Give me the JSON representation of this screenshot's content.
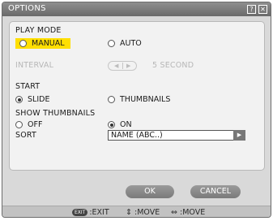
{
  "window": {
    "title": "OPTIONS",
    "help_icon": "?",
    "close_icon": "✕"
  },
  "play_mode": {
    "label": "PLAY MODE",
    "manual": "MANUAL",
    "auto": "AUTO",
    "selected": "MANUAL"
  },
  "interval": {
    "label": "INTERVAL",
    "left_arrow": "◀",
    "right_arrow": "▶",
    "value": "5 SECOND"
  },
  "start": {
    "label": "START",
    "slide": "SLIDE",
    "thumbnails": "THUMBNAILS",
    "selected": "SLIDE"
  },
  "show_thumbnails": {
    "label": "SHOW THUMBNAILS",
    "off": "OFF",
    "on": "ON",
    "selected": "ON"
  },
  "sort": {
    "label": "SORT",
    "value": "NAME (ABC..)",
    "arrow": "▶"
  },
  "buttons": {
    "ok": "OK",
    "cancel": "CANCEL"
  },
  "hints": {
    "exit_key": "EXIT",
    "exit": ":EXIT",
    "move_v_icon": "⇕",
    "move_v": ":MOVE",
    "move_h_icon": "⇔",
    "move_h": ":MOVE"
  },
  "colors": {
    "highlight": "#ffdf00",
    "titlebar": "#7a7a7a",
    "background": "#d9d9d9"
  }
}
